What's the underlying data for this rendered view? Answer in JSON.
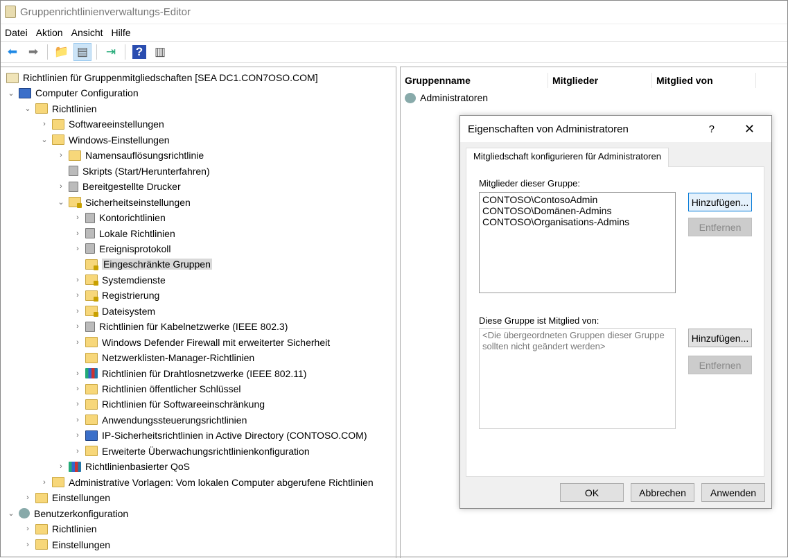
{
  "window": {
    "title": "Gruppenrichtlinienverwaltungs-Editor"
  },
  "menu": [
    "Datei",
    "Aktion",
    "Ansicht",
    "Hilfe"
  ],
  "toolbar": [
    {
      "icon": "back-arrow-icon",
      "g": "⬅",
      "c": "#1e88e5"
    },
    {
      "icon": "forward-arrow-icon",
      "g": "➡",
      "c": "#777"
    },
    {
      "icon": "up-folder-icon",
      "g": "📁",
      "c": "#c9a640"
    },
    {
      "icon": "show-hide-tree-icon",
      "g": "▤",
      "c": "#555",
      "active": true
    },
    {
      "icon": "export-list-icon",
      "g": "⇥",
      "c": "#2a7"
    },
    {
      "icon": "help-icon",
      "g": "?",
      "c": "#fff",
      "bg": "#2a4db0"
    },
    {
      "icon": "action-pane-icon",
      "g": "▥",
      "c": "#555"
    }
  ],
  "tree": [
    {
      "level": 0,
      "label": "Richtlinien für Gruppenmitgliedschaften [SEA DC1.CON7OSO.COM]",
      "icon": "scroll",
      "chev": ""
    },
    {
      "level": 1,
      "label": "Computer Configuration",
      "icon": "comp",
      "chev": "down"
    },
    {
      "level": 2,
      "label": "Richtlinien",
      "icon": "folder",
      "chev": "down"
    },
    {
      "level": 3,
      "label": "Softwareeinstellungen",
      "icon": "folder",
      "chev": "right"
    },
    {
      "level": 3,
      "label": "Windows-Einstellungen",
      "icon": "folder",
      "chev": "down"
    },
    {
      "level": 4,
      "label": "Namensauflösungsrichtlinie",
      "icon": "folder",
      "chev": "right"
    },
    {
      "level": 4,
      "label": "Skripts (Start/Herunterfahren)",
      "icon": "srv",
      "chev": ""
    },
    {
      "level": 4,
      "label": "Bereitgestellte Drucker",
      "icon": "srv",
      "chev": "right"
    },
    {
      "level": 4,
      "label": "Sicherheitseinstellungen",
      "icon": "lockf",
      "chev": "down"
    },
    {
      "level": 5,
      "label": "Kontorichtlinien",
      "icon": "srv",
      "chev": "right"
    },
    {
      "level": 5,
      "label": "Lokale Richtlinien",
      "icon": "srv",
      "chev": "right"
    },
    {
      "level": 5,
      "label": "Ereignisprotokoll",
      "icon": "srv",
      "chev": "right"
    },
    {
      "level": 5,
      "label": "Eingeschränkte Gruppen",
      "icon": "lockf",
      "chev": "",
      "selected": true
    },
    {
      "level": 5,
      "label": "Systemdienste",
      "icon": "lockf",
      "chev": "right"
    },
    {
      "level": 5,
      "label": "Registrierung",
      "icon": "lockf",
      "chev": "right"
    },
    {
      "level": 5,
      "label": "Dateisystem",
      "icon": "lockf",
      "chev": "right"
    },
    {
      "level": 5,
      "label": "Richtlinien für Kabelnetzwerke (IEEE 802.3)",
      "icon": "srv",
      "chev": "right"
    },
    {
      "level": 5,
      "label": "Windows Defender Firewall mit erweiterter Sicherheit",
      "icon": "folder",
      "chev": "right"
    },
    {
      "level": 5,
      "label": "Netzwerklisten-Manager-Richtlinien",
      "icon": "folder",
      "chev": ""
    },
    {
      "level": 5,
      "label": "Richtlinien für Drahtlosnetzwerke (IEEE 802.11)",
      "icon": "chart",
      "chev": "right"
    },
    {
      "level": 5,
      "label": "Richtlinien öffentlicher Schlüssel",
      "icon": "folder",
      "chev": "right"
    },
    {
      "level": 5,
      "label": "Richtlinien für Softwareeinschränkung",
      "icon": "folder",
      "chev": "right"
    },
    {
      "level": 5,
      "label": "Anwendungssteuerungsrichtlinien",
      "icon": "folder",
      "chev": "right"
    },
    {
      "level": 5,
      "label": "IP-Sicherheitsrichtlinien in Active Directory (CONTOSO.COM)",
      "icon": "comp",
      "chev": "right"
    },
    {
      "level": 5,
      "label": "Erweiterte Überwachungsrichtlinienkonfiguration",
      "icon": "folder",
      "chev": "right"
    },
    {
      "level": 4,
      "label": "Richtlinienbasierter QoS",
      "icon": "chart",
      "chev": "right"
    },
    {
      "level": 3,
      "label": "Administrative Vorlagen: Vom lokalen Computer abgerufene Richtlinien",
      "icon": "folder",
      "chev": "right"
    },
    {
      "level": 2,
      "label": "Einstellungen",
      "icon": "folder",
      "chev": "right"
    },
    {
      "level": 1,
      "label": "Benutzerkonfiguration",
      "icon": "user",
      "chev": "down"
    },
    {
      "level": 2,
      "label": "Richtlinien",
      "icon": "folder",
      "chev": "right"
    },
    {
      "level": 2,
      "label": "Einstellungen",
      "icon": "folder",
      "chev": "right"
    }
  ],
  "list": {
    "columns": [
      "Gruppenname",
      "Mitglieder",
      "Mitglied von"
    ],
    "rows": [
      "Administratoren"
    ]
  },
  "dialog": {
    "title": "Eigenschaften von Administratoren",
    "help": "?",
    "close": "✕",
    "tab": "Mitgliedschaft konfigurieren für Administratoren",
    "members_label": "Mitglieder dieser Gruppe:",
    "members": [
      "CONTOSO\\ContosoAdmin",
      "CONTOSO\\Domänen-Admins",
      "CONTOSO\\Organisations-Admins"
    ],
    "memberof_label": "Diese Gruppe ist Mitglied von:",
    "memberof_placeholder": "<Die übergeordneten Gruppen dieser Gruppe sollten nicht geändert werden>",
    "add": "Hinzufügen...",
    "remove": "Entfernen",
    "ok": "OK",
    "cancel": "Abbrechen",
    "apply": "Anwenden"
  }
}
